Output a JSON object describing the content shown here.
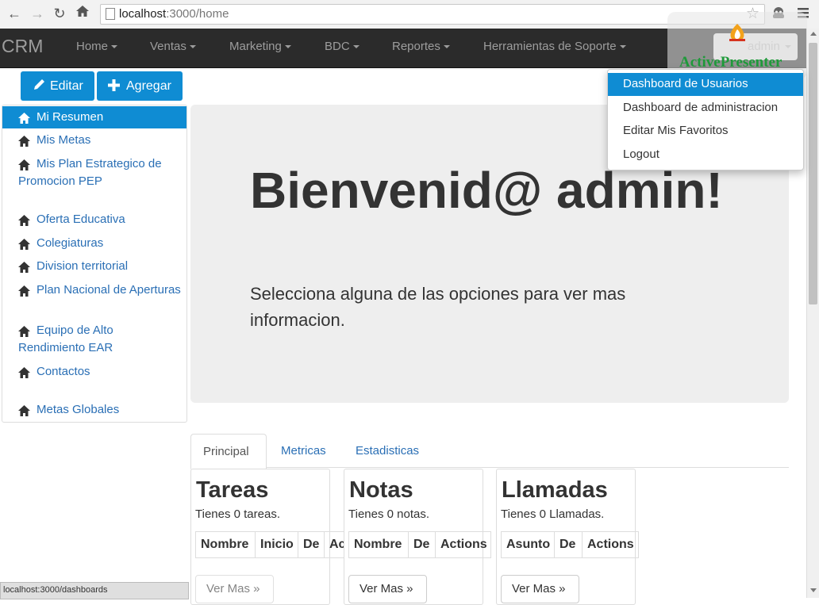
{
  "browser": {
    "url_host": "localhost",
    "url_path": ":3000/home",
    "status_text": "localhost:3000/dashboards"
  },
  "navbar": {
    "brand": "CRM",
    "items": [
      {
        "label": "Home"
      },
      {
        "label": "Ventas"
      },
      {
        "label": "Marketing"
      },
      {
        "label": "BDC"
      },
      {
        "label": "Reportes"
      },
      {
        "label": "Herramientas de Soporte"
      }
    ],
    "user": "admin"
  },
  "actions": {
    "edit_label": "Editar",
    "add_label": "Agregar"
  },
  "sidebar": {
    "items": [
      {
        "label": "Mi Resumen",
        "active": true
      },
      {
        "label": "Mis Metas"
      },
      {
        "label": "Mis Plan Estrategico de Promocion PEP"
      },
      {
        "label": "Oferta Educativa"
      },
      {
        "label": "Colegiaturas"
      },
      {
        "label": "Division territorial"
      },
      {
        "label": "Plan Nacional de Aperturas"
      },
      {
        "label": "Equipo de Alto Rendimiento EAR"
      },
      {
        "label": "Contactos"
      },
      {
        "label": "Metas Globales"
      }
    ]
  },
  "jumbotron": {
    "title": "Bienvenid@ admin!",
    "subtitle": "Selecciona alguna de las opciones para ver mas informacion."
  },
  "tabs": [
    {
      "label": "Principal",
      "active": true
    },
    {
      "label": "Metricas"
    },
    {
      "label": "Estadisticas"
    }
  ],
  "panels": [
    {
      "title": "Tareas",
      "subtitle": "Tienes 0 tareas.",
      "columns": [
        "Nombre",
        "Inicio",
        "De",
        "Actions"
      ],
      "button": "Ver Mas »"
    },
    {
      "title": "Notas",
      "subtitle": "Tienes 0 notas.",
      "columns": [
        "Nombre",
        "De",
        "Actions"
      ],
      "button": "Ver Mas »"
    },
    {
      "title": "Llamadas",
      "subtitle": "Tienes 0 Llamadas.",
      "columns": [
        "Asunto",
        "De",
        "Actions"
      ],
      "button": "Ver Mas »"
    }
  ],
  "dropdown": {
    "items": [
      {
        "label": "Dashboard de Usuarios",
        "active": true
      },
      {
        "label": "Dashboard de administracion"
      },
      {
        "label": "Editar Mis Favoritos"
      },
      {
        "label": "Logout"
      }
    ]
  },
  "watermark": {
    "text": "ActivePresenter"
  },
  "colors": {
    "primary": "#0f8cd3",
    "navbar_bg": "#2b2b2b",
    "link": "#2a6fb5",
    "jumbotron_bg": "#eeeeee"
  }
}
